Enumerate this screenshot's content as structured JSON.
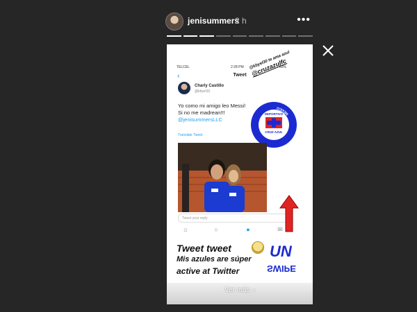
{
  "story": {
    "username": "jenisummers",
    "time_ago": "2 h",
    "more_label": "•••",
    "progress_segments": 9,
    "progress_current": 3,
    "close_icon": "close-icon"
  },
  "screenshot": {
    "carrier": "TELCEL",
    "time": "2:28 PM",
    "battery": "63%",
    "nav_title": "Tweet",
    "author_name": "Charly Castillo",
    "author_handle": "@kbyel10",
    "tweet_line1": "Yo como mi amigo leo Messi!",
    "tweet_line2": "Si no me madrean!!!",
    "tweet_mention": "@jenisummersLLC",
    "translate": "Translate Tweet",
    "reply_placeholder": "Tweet your reply"
  },
  "stickers": {
    "handle_small": "@kbyel30 te ama azul",
    "handle_big": "@cruzazulfc",
    "crest_top": "DEPORTIVO",
    "crest_bottom": "CRUZ AZUL",
    "crest_ring": "MEXICO"
  },
  "banner": {
    "line1": "Tweet tweet",
    "line2": "Mis azules are súper",
    "line3": "active at Twitter",
    "logo_un": "UN",
    "logo_swipe": "SWIPE"
  },
  "cta": {
    "label": "Ver más"
  },
  "colors": {
    "background": "#262626",
    "twitter_blue": "#1da1f2",
    "cruz_azul_blue": "#1b2bd1",
    "arrow_red": "#e02424"
  }
}
